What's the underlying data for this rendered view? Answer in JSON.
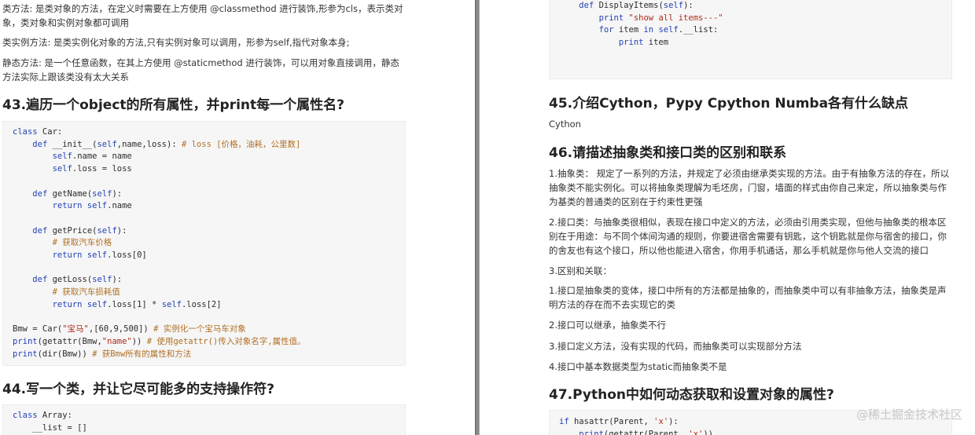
{
  "left": {
    "intro": [
      "类方法: 是类对象的方法，在定义时需要在上方使用 @classmethod 进行装饰,形参为cls，表示类对象，类对象和实例对象都可调用",
      "类实例方法: 是类实例化对象的方法,只有实例对象可以调用，形参为self,指代对象本身;",
      "静态方法: 是一个任意函数，在其上方使用 @staticmethod 进行装饰，可以用对象直接调用，静态方法实际上跟该类没有太大关系"
    ],
    "heading43": "43.遍历一个object的所有属性，并print每一个属性名?",
    "heading44": "44.写一个类，并让它尽可能多的支持操作符?",
    "code43": [
      "class Car:",
      "    def __init__(self,name,loss): # loss [价格，油耗，公里数]",
      "        self.name = name",
      "        self.loss = loss",
      "",
      "    def getName(self):",
      "        return self.name",
      "",
      "    def getPrice(self):",
      "        # 获取汽车价格",
      "        return self.loss[0]",
      "",
      "    def getLoss(self):",
      "        # 获取汽车损耗值",
      "        return self.loss[1] * self.loss[2]",
      "",
      "Bmw = Car(\"宝马\",[60,9,500]) # 实例化一个宝马车对象",
      "print(getattr(Bmw,\"name\")) # 使用getattr()传入对象名字,属性值。",
      "print(dir(Bmw)) # 获Bmw所有的属性和方法"
    ],
    "code44": [
      "class Array:",
      "    __list = []"
    ]
  },
  "right": {
    "code_top": [
      "    def DisplayItems(self):",
      "        print \"show all items---\"",
      "        for item in self.__list:",
      "            print item"
    ],
    "heading45": "45.介绍Cython，Pypy Cpython Numba各有什么缺点",
    "text45": "Cython",
    "heading46": "46.请描述抽象类和接口类的区别和联系",
    "para46_1": "1.抽象类： 规定了一系列的方法，并规定了必须由继承类实现的方法。由于有抽象方法的存在，所以抽象类不能实例化。可以将抽象类理解为毛坯房，门窗，墙面的样式由你自己来定，所以抽象类与作为基类的普通类的区别在于约束性更强",
    "para46_2": "2.接口类：与抽象类很相似，表现在接口中定义的方法，必须由引用类实现，但他与抽象类的根本区别在于用途：与不同个体间沟通的规则，你要进宿舍需要有钥匙，这个钥匙就是你与宿舍的接口，你的舍友也有这个接口，所以他也能进入宿舍，你用手机通话，那么手机就是你与他人交流的接口",
    "para46_3": "3.区别和关联：",
    "para46_4": "1.接口是抽象类的变体，接口中所有的方法都是抽象的，而抽象类中可以有非抽象方法，抽象类是声明方法的存在而不去实现它的类",
    "para46_5": "2.接口可以继承，抽象类不行",
    "para46_6": "3.接口定义方法，没有实现的代码，而抽象类可以实现部分方法",
    "para46_7": "4.接口中基本数据类型为static而抽象类不是",
    "heading47": "47.Python中如何动态获取和设置对象的属性?",
    "code47": [
      "if hasattr(Parent, 'x'):",
      "    print(getattr(Parent, 'x'))"
    ]
  },
  "watermark": "@稀土掘金技术社区"
}
